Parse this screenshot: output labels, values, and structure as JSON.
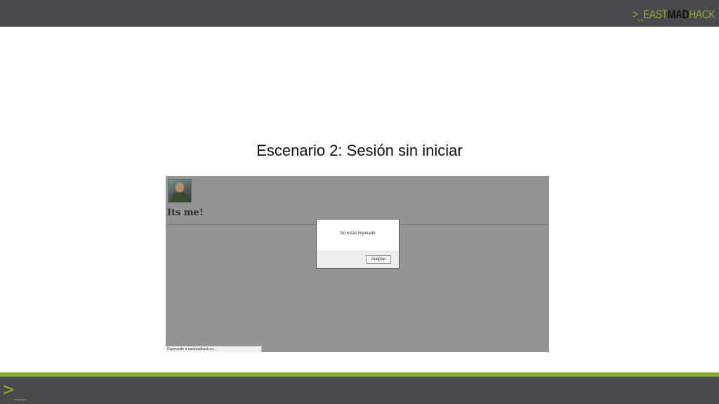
{
  "header": {
    "logo": {
      "prompt": ">",
      "east": "_EAST",
      "mad": "MAD",
      "hack": "HACK"
    }
  },
  "slide": {
    "title": "Escenario 2: Sesión sin iniciar"
  },
  "screenshot": {
    "heading": "Its me!",
    "dialog": {
      "message": "No estás logueado",
      "ok_label": "Aceptar"
    },
    "status": "Esperando a eastmadhack.es..."
  },
  "footer": {
    "prompt": ">_"
  },
  "colors": {
    "bar": "#4a494e",
    "accent": "#86ad2d",
    "screenshot_bg": "#939496"
  }
}
